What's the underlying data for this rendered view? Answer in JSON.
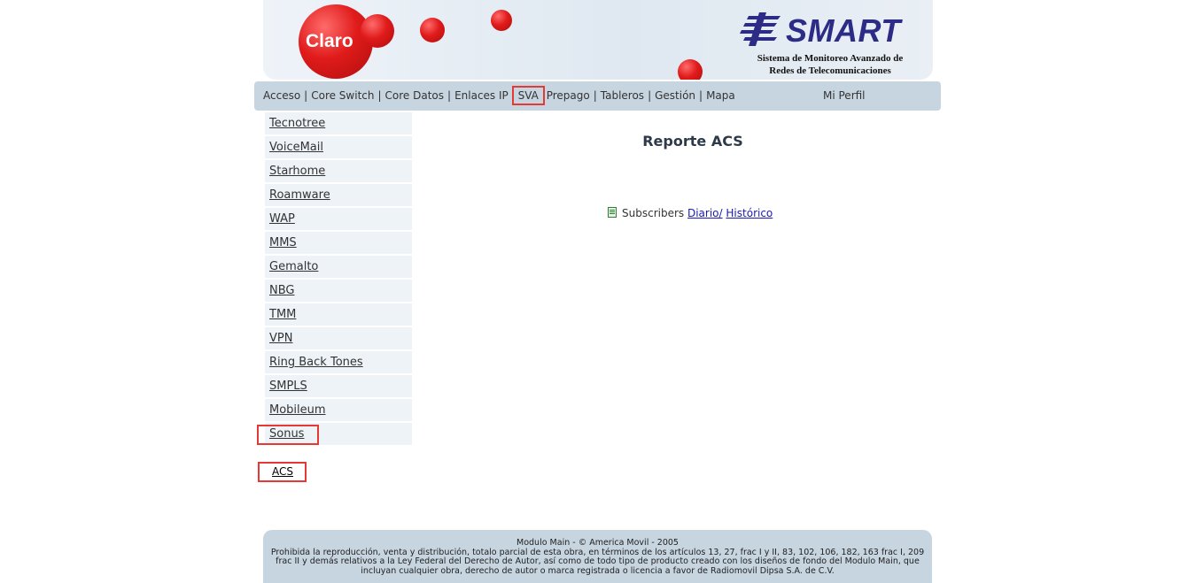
{
  "header": {
    "claro_logo": "Claro",
    "smart_logo": "SMART",
    "smart_subtitle_line1": "Sistema de Monitoreo Avanzado de",
    "smart_subtitle_line2": "Redes de Telecomunicaciones"
  },
  "nav": {
    "items": [
      "Acceso",
      "Core Switch",
      "Core Datos",
      "Enlaces IP",
      "SVA",
      "Prepago",
      "Tableros",
      "Gestión",
      "Mapa"
    ],
    "perfil": "Mi Perfil"
  },
  "sidebar": {
    "items": [
      "Tecnotree",
      "VoiceMail",
      "Starhome",
      "Roamware",
      "WAP",
      "MMS",
      "Gemalto",
      "NBG",
      "TMM",
      "VPN",
      "Ring Back Tones",
      "SMPLS",
      "Mobileum",
      "Sonus"
    ],
    "sub_link": "ACS"
  },
  "main": {
    "title": "Reporte ACS",
    "report_label": "Subscribers",
    "link_diario": "Diario/",
    "link_historico": "Histórico"
  },
  "footer": {
    "line1": "Modulo Main - © America Movil - 2005",
    "line2": "Prohibida la reproducción, venta y distribución, totalo parcial de esta obra, en términos de los artículos 13, 27, frac I y II, 83, 102, 106, 182, 163 frac I, 209 frac II y demás relativos a la Ley Federal del Derecho de Autor, así como de todo tipo de producto creado con los diseños de fondo del Modulo Main, que incluyan cualquier obra, derecho de autor o marca registrada o licencia a favor de Radiomovil Dipsa S.A. de C.V."
  },
  "colors": {
    "highlight_box": "#e53935",
    "navbar_bg": "#c7d5e0",
    "sidebar_item_bg": "#eef3f7",
    "link": "#1a1ab8"
  }
}
